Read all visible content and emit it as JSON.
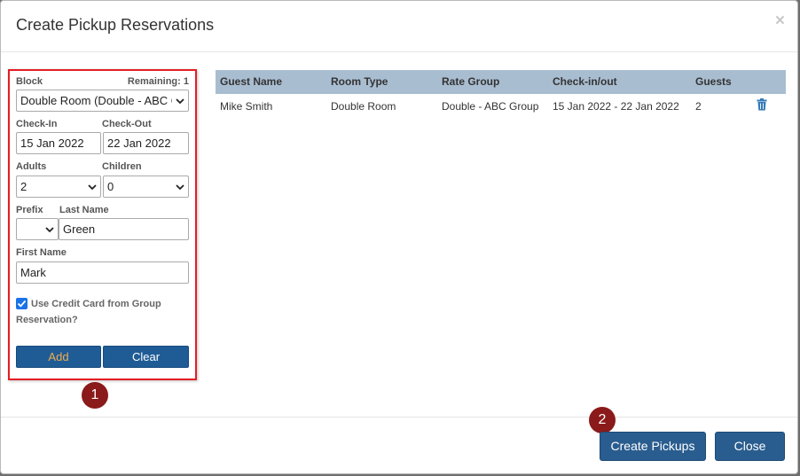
{
  "dialog": {
    "title": "Create Pickup Reservations",
    "close_glyph": "×"
  },
  "form": {
    "block_label": "Block",
    "remaining_label": "Remaining: 1",
    "block_value": "Double Room (Double - ABC Group)",
    "checkin_label": "Check-In",
    "checkout_label": "Check-Out",
    "checkin_value": "15 Jan 2022",
    "checkout_value": "22 Jan 2022",
    "adults_label": "Adults",
    "children_label": "Children",
    "adults_value": "2",
    "children_value": "0",
    "prefix_label": "Prefix",
    "lastname_label": "Last Name",
    "prefix_value": "",
    "lastname_value": "Green",
    "firstname_label": "First Name",
    "firstname_value": "Mark",
    "use_cc_checked": true,
    "use_cc_label": "Use Credit Card from Group Reservation?",
    "add_label": "Add",
    "clear_label": "Clear"
  },
  "annotations": {
    "badge_1": "1",
    "badge_2": "2",
    "badge_color": "#8b1a1a",
    "highlight_color": "#e31e24"
  },
  "table": {
    "headers": [
      "Guest Name",
      "Room Type",
      "Rate Group",
      "Check-in/out",
      "Guests"
    ],
    "rows": [
      {
        "guest_name": "Mike Smith",
        "room_type": "Double Room",
        "rate_group": "Double - ABC Group",
        "check_in_out": "15 Jan 2022 - 22 Jan 2022",
        "guests": "2",
        "action_icon": "trash-icon"
      }
    ]
  },
  "footer": {
    "create_label": "Create Pickups",
    "close_label": "Close"
  },
  "colors": {
    "primary_button": "#1f5c96",
    "table_header": "#a9bdd1",
    "add_text": "#f0ad4e"
  }
}
